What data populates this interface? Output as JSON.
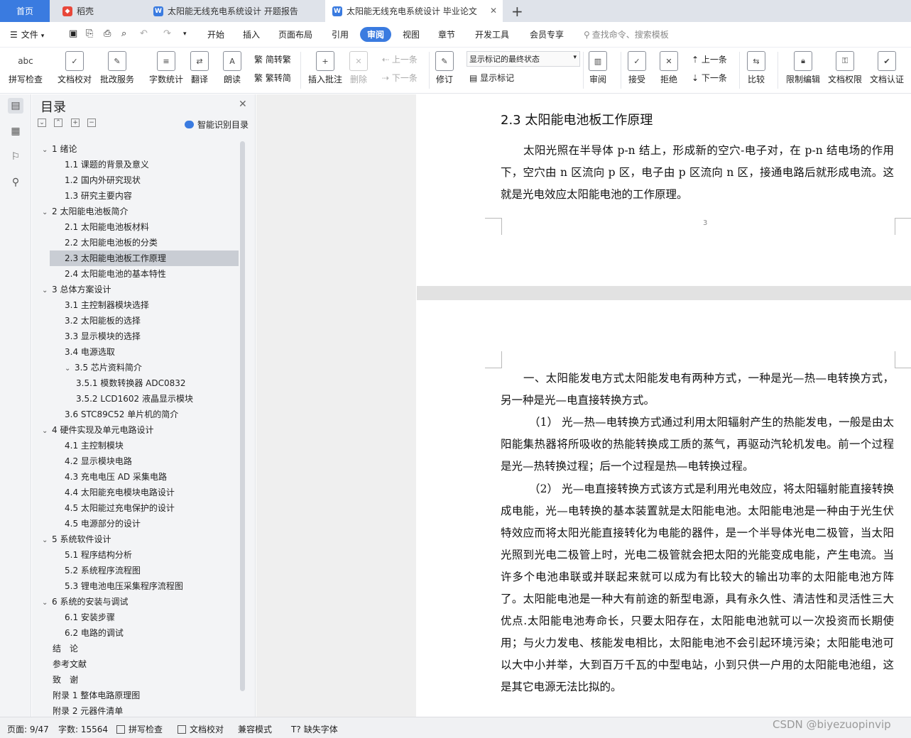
{
  "tabs": [
    {
      "label": "首页",
      "active": false,
      "home": true
    },
    {
      "label": "稻壳",
      "icon": "docer-icon"
    },
    {
      "label": "太阳能无线充电系统设计 开题报告",
      "icon": "wps-writer-icon"
    },
    {
      "label": "太阳能无线充电系统设计 毕业论文",
      "icon": "wps-writer-icon",
      "active": true
    }
  ],
  "add_tab": "+",
  "menu": {
    "file": "文件",
    "items": [
      "开始",
      "插入",
      "页面布局",
      "引用",
      "审阅",
      "视图",
      "章节",
      "开发工具",
      "会员专享"
    ],
    "active": "审阅",
    "search": "查找命令、搜索模板"
  },
  "toolbar": {
    "spell": "拼写检查",
    "spell_glyph": "abc",
    "proof": "文档校对",
    "annot": "批改服务",
    "count": "字数统计",
    "translate": "翻译",
    "read": "朗读",
    "t2s": "简转繁",
    "s2t": "繁转简",
    "insert_comment": "插入批注",
    "delete": "删除",
    "prev": "上一条",
    "next": "下一条",
    "revise": "修订",
    "display_state": "显示标记的最终状态",
    "show_marks": "显示标记",
    "review": "审阅",
    "accept": "接受",
    "reject": "拒绝",
    "prev2": "上一条",
    "next2": "下一条",
    "compare": "比较",
    "restrict": "限制编辑",
    "rights": "文档权限",
    "certify": "文档认证"
  },
  "toc": {
    "title": "目录",
    "smart": "智能识别目录",
    "items": [
      {
        "label": "1 绪论",
        "level": 1,
        "collapsible": true
      },
      {
        "label": "1.1 课题的背景及意义",
        "level": 2
      },
      {
        "label": "1.2 国内外研究现状",
        "level": 2
      },
      {
        "label": "1.3 研究主要内容",
        "level": 2
      },
      {
        "label": "2 太阳能电池板简介",
        "level": 1,
        "collapsible": true
      },
      {
        "label": "2.1 太阳能电池板材料",
        "level": 2
      },
      {
        "label": "2.2 太阳能电池板的分类",
        "level": 2
      },
      {
        "label": "2.3 太阳能电池板工作原理",
        "level": 2,
        "selected": true
      },
      {
        "label": "2.4 太阳能电池的基本特性",
        "level": 2
      },
      {
        "label": "3 总体方案设计",
        "level": 1,
        "collapsible": true
      },
      {
        "label": "3.1 主控制器模块选择",
        "level": 2
      },
      {
        "label": "3.2 太阳能板的选择",
        "level": 2
      },
      {
        "label": "3.3 显示模块的选择",
        "level": 2
      },
      {
        "label": "3.4 电源选取",
        "level": 2
      },
      {
        "label": "3.5 芯片资料简介",
        "level": 2,
        "collapsible": true
      },
      {
        "label": "3.5.1 模数转换器 ADC0832",
        "level": 3
      },
      {
        "label": "3.5.2 LCD1602 液晶显示模块",
        "level": 3
      },
      {
        "label": "3.6 STC89C52 单片机的简介",
        "level": 2
      },
      {
        "label": "4 硬件实现及单元电路设计",
        "level": 1,
        "collapsible": true
      },
      {
        "label": "4.1 主控制模块",
        "level": 2
      },
      {
        "label": "4.2 显示模块电路",
        "level": 2
      },
      {
        "label": "4.3 充电电压 AD 采集电路",
        "level": 2
      },
      {
        "label": "4.4 太阳能充电模块电路设计",
        "level": 2
      },
      {
        "label": "4.5 太阳能过充电保护的设计",
        "level": 2
      },
      {
        "label": "4.5 电源部分的设计",
        "level": 2
      },
      {
        "label": "5 系统软件设计",
        "level": 1,
        "collapsible": true
      },
      {
        "label": "5.1 程序结构分析",
        "level": 2
      },
      {
        "label": "5.2 系统程序流程图",
        "level": 2
      },
      {
        "label": "5.3 锂电池电压采集程序流程图",
        "level": 2
      },
      {
        "label": "6 系统的安装与调试",
        "level": 1,
        "collapsible": true
      },
      {
        "label": "6.1 安装步骤",
        "level": 2
      },
      {
        "label": "6.2 电路的调试",
        "level": 2
      },
      {
        "label": "结　论",
        "level": 0
      },
      {
        "label": "参考文献",
        "level": 0
      },
      {
        "label": "致　谢",
        "level": 0
      },
      {
        "label": "附录 1 整体电路原理图",
        "level": 0
      },
      {
        "label": "附录 2 元器件清单",
        "level": 0
      }
    ]
  },
  "doc": {
    "heading": "2.3 太阳能电池板工作原理",
    "page1_paragraph": "太阳光照在半导体 p-n 结上，形成新的空穴-电子对，在 p-n 结电场的作用下，空穴由 n 区流向 p 区，电子由 p 区流向 n 区，接通电路后就形成电流。这就是光电效应太阳能电池的工作原理。",
    "page_number": "3",
    "page2_paragraphs": [
      "一、太阳能发电方式太阳能发电有两种方式，一种是光—热—电转换方式，另一种是光—电直接转换方式。",
      "（1） 光—热—电转换方式通过利用太阳辐射产生的热能发电，一般是由太阳能集热器将所吸收的热能转换成工质的蒸气，再驱动汽轮机发电。前一个过程是光—热转换过程；后一个过程是热—电转换过程。",
      "（2） 光—电直接转换方式该方式是利用光电效应，将太阳辐射能直接转换成电能，光—电转换的基本装置就是太阳能电池。太阳能电池是一种由于光生伏特效应而将太阳光能直接转化为电能的器件，是一个半导体光电二极管，当太阳光照到光电二极管上时，光电二极管就会把太阳的光能变成电能，产生电流。当许多个电池串联或并联起来就可以成为有比较大的输出功率的太阳能电池方阵了。太阳能电池是一种大有前途的新型电源，具有永久性、清洁性和灵活性三大优点.太阳能电池寿命长，只要太阳存在，太阳能电池就可以一次投资而长期使用；与火力发电、核能发电相比，太阳能电池不会引起环境污染；太阳能电池可以大中小并举，大到百万千瓦的中型电站，小到只供一户用的太阳能电池组，这是其它电源无法比拟的。"
    ]
  },
  "status": {
    "page": "页面: 9/47",
    "words": "字数: 15564",
    "spell": "拼写检查",
    "proof": "文档校对",
    "compat": "兼容模式",
    "missing_font": "缺失字体"
  },
  "watermark": "CSDN @biyezuopinvip",
  "colors": {
    "accent": "#3a7be0",
    "home_tab": "#3a7be0",
    "active_menu_bg": "#3a7be0"
  }
}
